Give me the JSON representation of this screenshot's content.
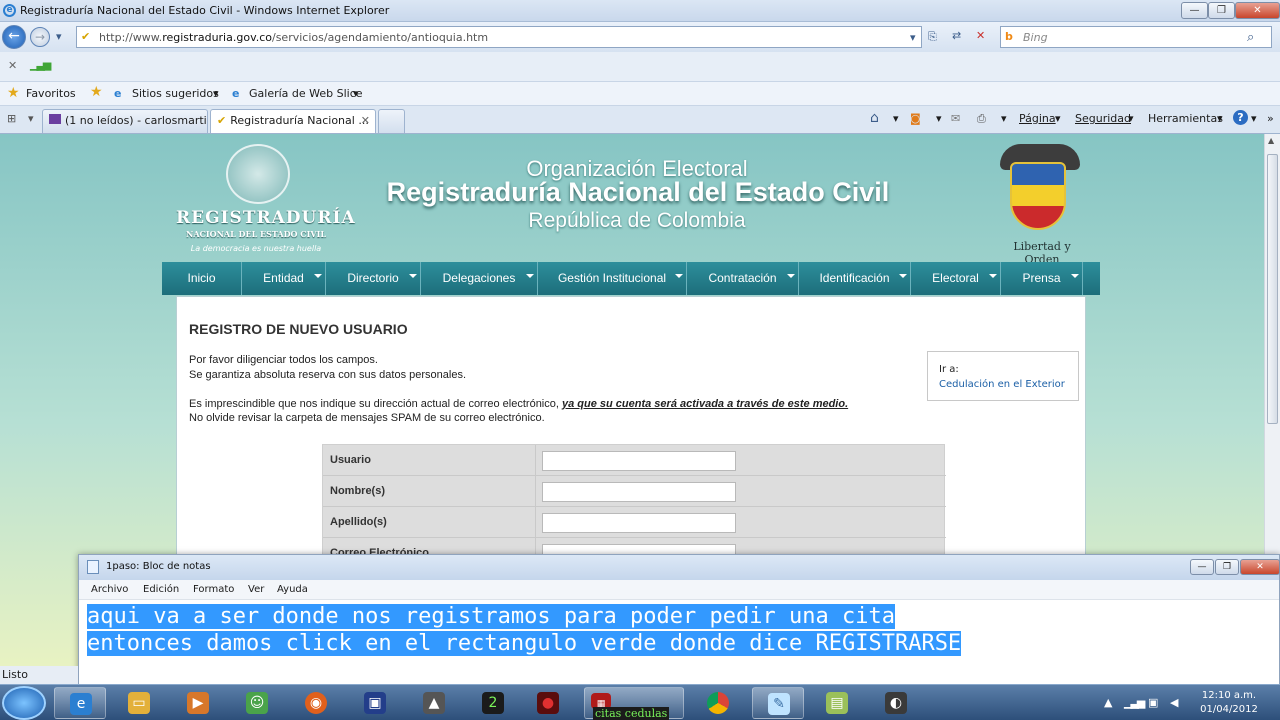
{
  "window": {
    "title": "Registraduría Nacional del Estado Civil - Windows Internet Explorer"
  },
  "address": {
    "url_prefix": "http://www.",
    "url_domain": "registraduria.gov.co",
    "url_path": "/servicios/agendamiento/antioquia.htm"
  },
  "search": {
    "placeholder": "Bing"
  },
  "favorites": {
    "label": "Favoritos",
    "items": [
      "Sitios sugeridos",
      "Galería de Web Slice"
    ]
  },
  "tabs": [
    {
      "label": "(1 no leídos) - carlosmarti..."
    },
    {
      "label": "Registraduría Nacional ..."
    }
  ],
  "commands": {
    "pagina": "Página",
    "seguridad": "Seguridad",
    "herramientas": "Herramientas"
  },
  "site": {
    "brand_line1": "REGISTRADURÍA",
    "brand_line2": "NACIONAL DEL ESTADO CIVIL",
    "brand_tagline": "La democracia es nuestra huella",
    "header_line1": "Organización Electoral",
    "header_line2": "Registraduría Nacional del Estado Civil",
    "header_line3": "República de Colombia",
    "motto": "Libertad y Orden",
    "menu": [
      "Inicio",
      "Entidad",
      "Directorio",
      "Delegaciones",
      "Gestión Institucional",
      "Contratación",
      "Identificación",
      "Electoral",
      "Prensa"
    ]
  },
  "content": {
    "title": "REGISTRO DE NUEVO USUARIO",
    "p1": "Por favor diligenciar todos los campos.",
    "p2": "Se garantiza absoluta reserva con sus datos personales.",
    "p3": "Es imprescindible que nos indique su dirección actual de correo electrónico,",
    "p3_emph": "ya que su cuenta será activada a través de este medio.",
    "p4": "No olvide revisar la carpeta de mensajes SPAM de su correo electrónico.",
    "ir_label": "Ir a:",
    "ir_link": "Cedulación en el Exterior",
    "fields": [
      "Usuario",
      "Nombre(s)",
      "Apellido(s)",
      "Correo Electrónico"
    ]
  },
  "notepad": {
    "title": "1paso: Bloc de notas",
    "menu": [
      "Archivo",
      "Edición",
      "Formato",
      "Ver",
      "Ayuda"
    ],
    "line1": "aqui va a ser donde nos registramos para poder pedir una cita",
    "line2": "entonces damos click en el rectangulo verde donde dice REGISTRARSE"
  },
  "status": {
    "text": "Listo"
  },
  "taskbar": {
    "item_label": "citas cedulas",
    "time": "12:10 a.m.",
    "date": "01/04/2012"
  }
}
